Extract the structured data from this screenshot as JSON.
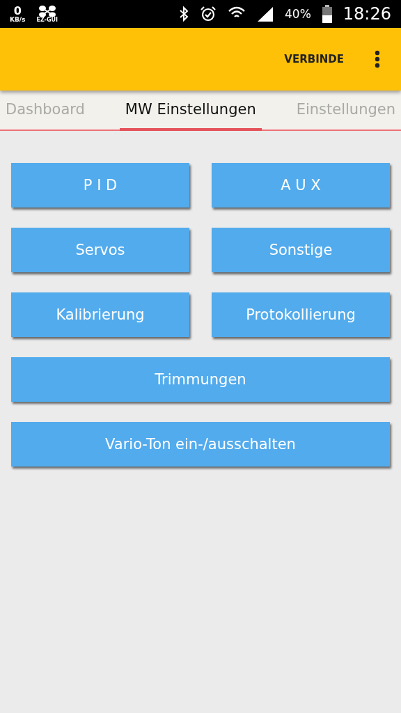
{
  "status_bar": {
    "speed_value": "0",
    "speed_unit": "KB/s",
    "app_badge": "EZ-GUI",
    "battery": "40%",
    "time": "18:26"
  },
  "app_bar": {
    "action": "VERBINDE"
  },
  "tabs": [
    {
      "label": "Dashboard",
      "selected": false
    },
    {
      "label": "MW Einstellungen",
      "selected": true
    },
    {
      "label": "Einstellungen",
      "selected": false
    }
  ],
  "buttons": [
    {
      "label": "P I D",
      "kind": "half"
    },
    {
      "label": "A U X",
      "kind": "half"
    },
    {
      "label": "Servos",
      "kind": "half"
    },
    {
      "label": "Sonstige",
      "kind": "half"
    },
    {
      "label": "Kalibrierung",
      "kind": "half"
    },
    {
      "label": "Protokollierung",
      "kind": "half"
    },
    {
      "label": "Trimmungen",
      "kind": "full"
    },
    {
      "label": "Vario-Ton ein-/ausschalten",
      "kind": "full"
    }
  ]
}
